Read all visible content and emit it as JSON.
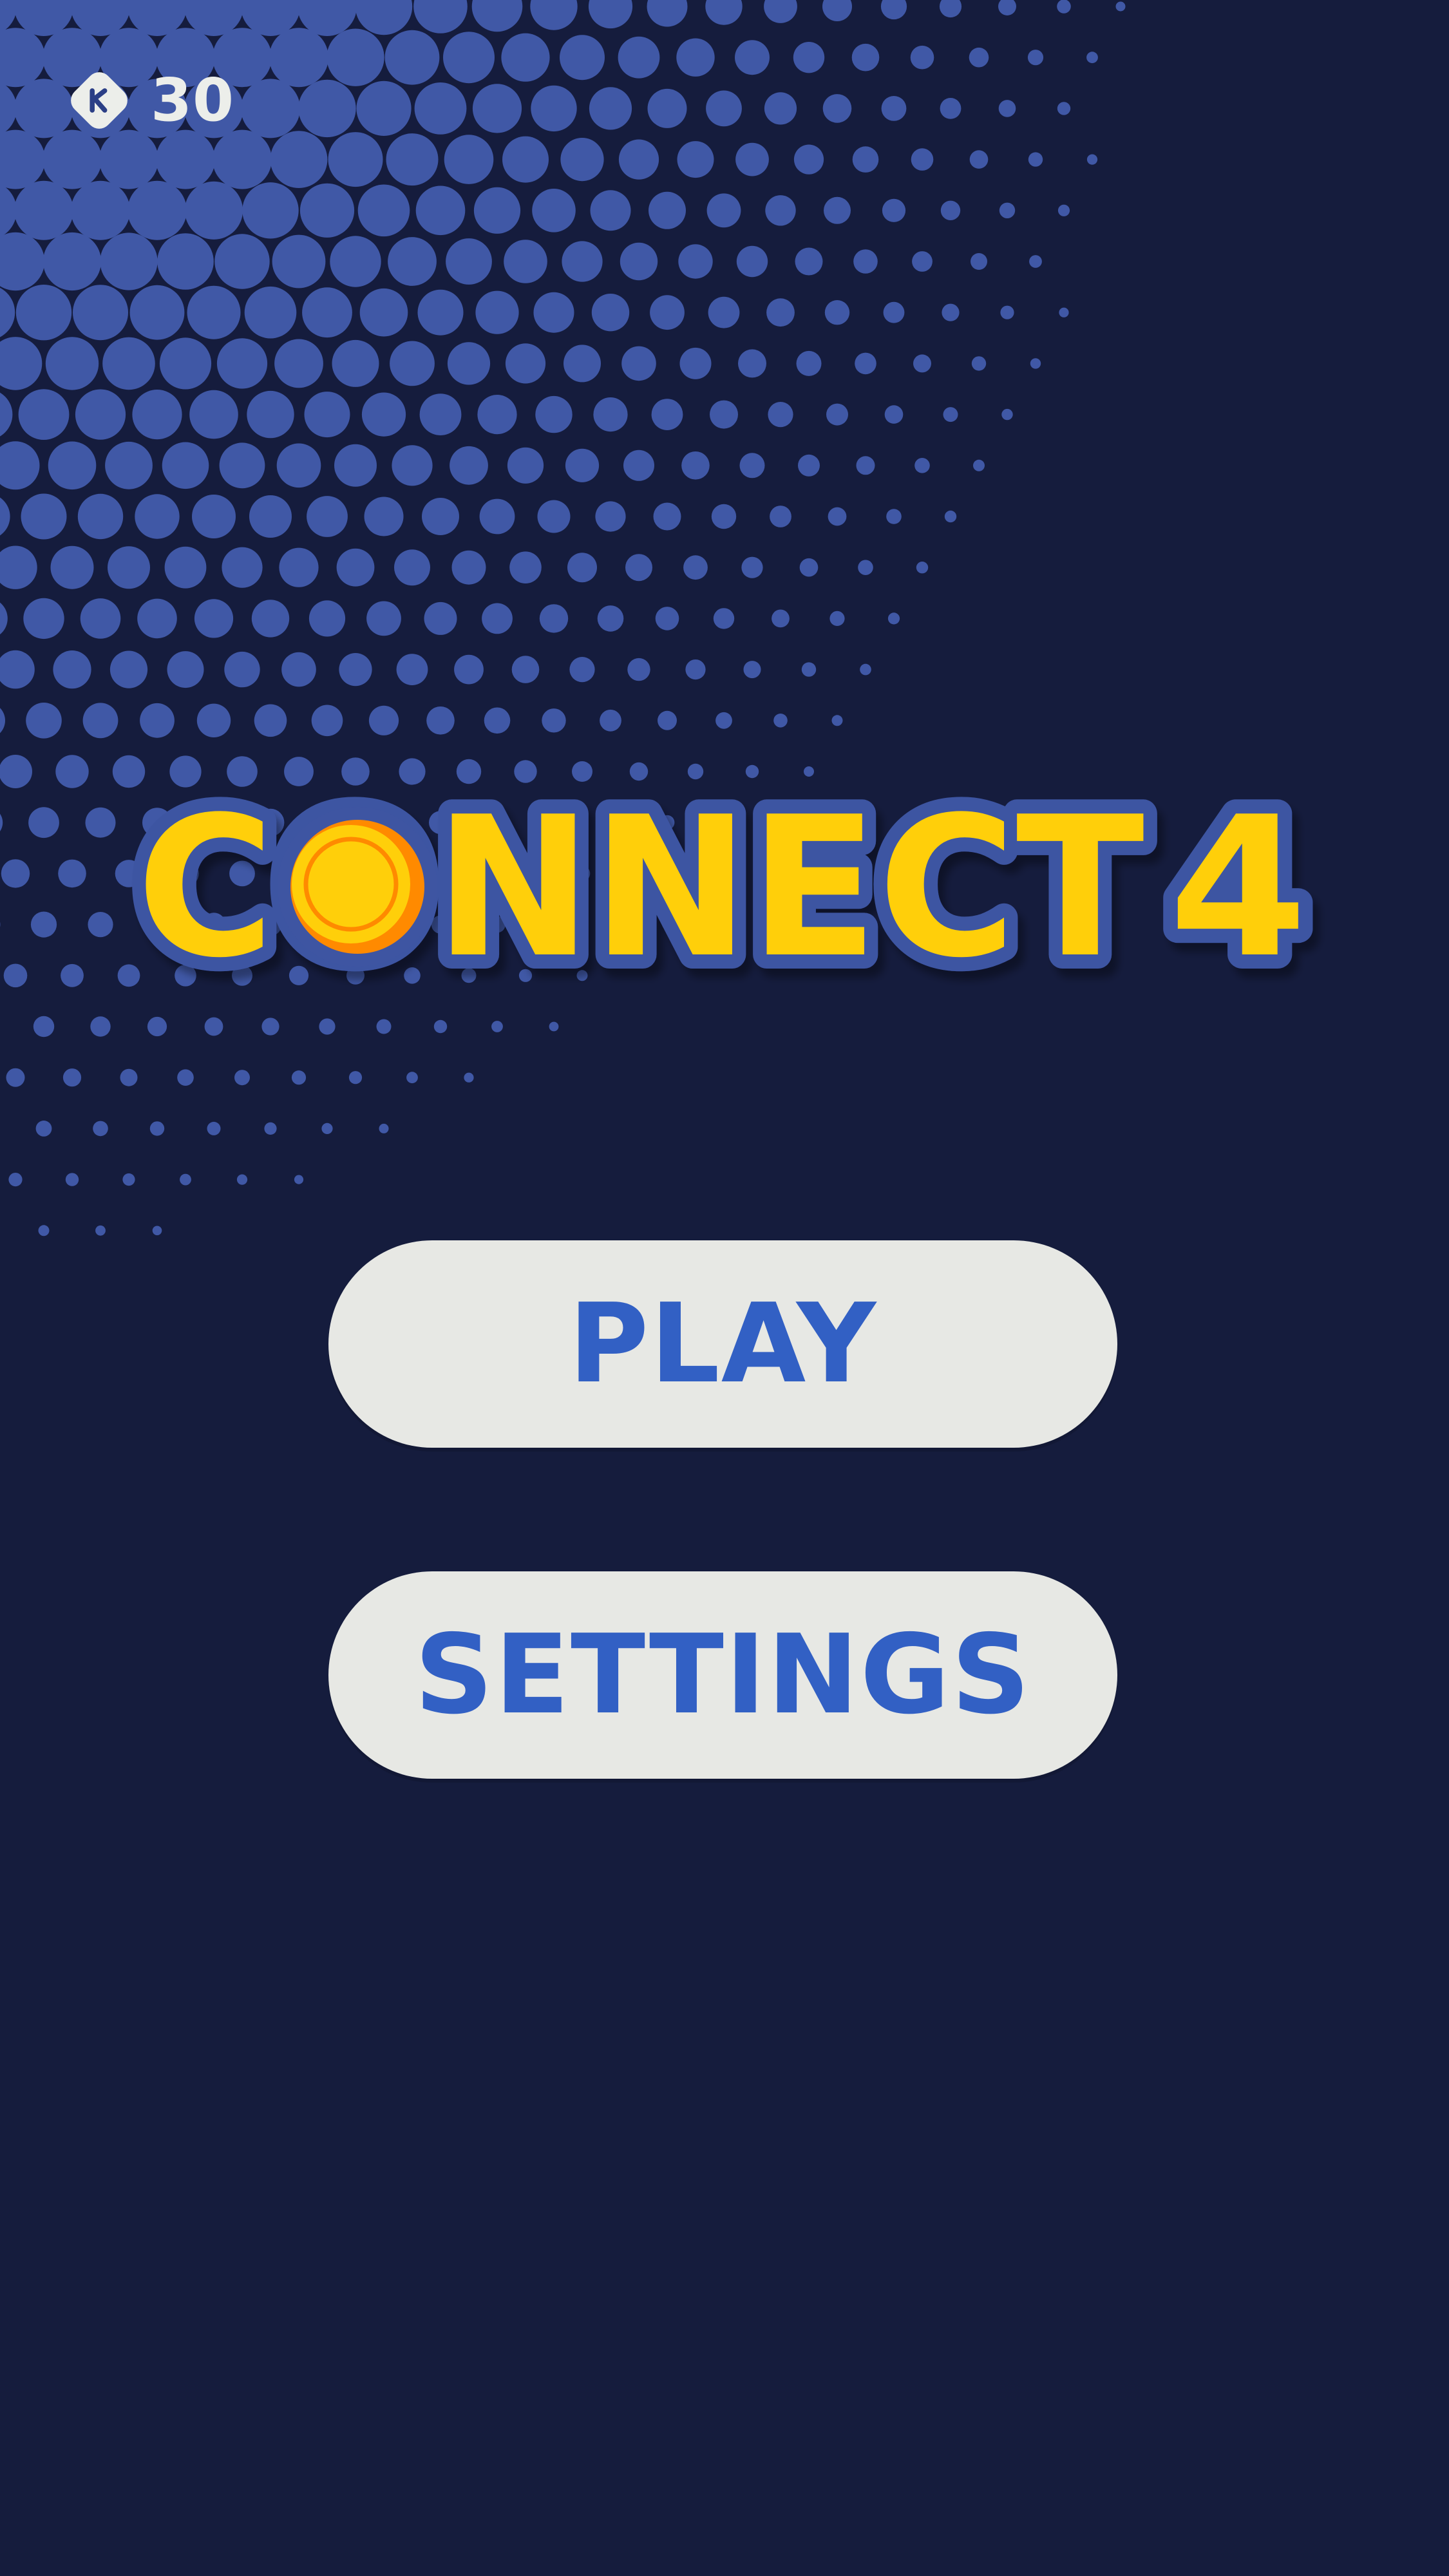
{
  "game": {
    "title_main": "CONNECT",
    "title_number": "4"
  },
  "hud": {
    "coins": "30",
    "coin_icon": "coin-gem-icon"
  },
  "menu": {
    "play_label": "PLAY",
    "settings_label": "SETTINGS"
  },
  "colors": {
    "background": "#151c3d",
    "dot": "#4058a6",
    "title_fill": "#ffcf0a",
    "title_outline": "#3e55a2",
    "coin_accent": "#ff8a00",
    "button_bg": "#e7e8e4",
    "button_text": "#3260c4"
  }
}
